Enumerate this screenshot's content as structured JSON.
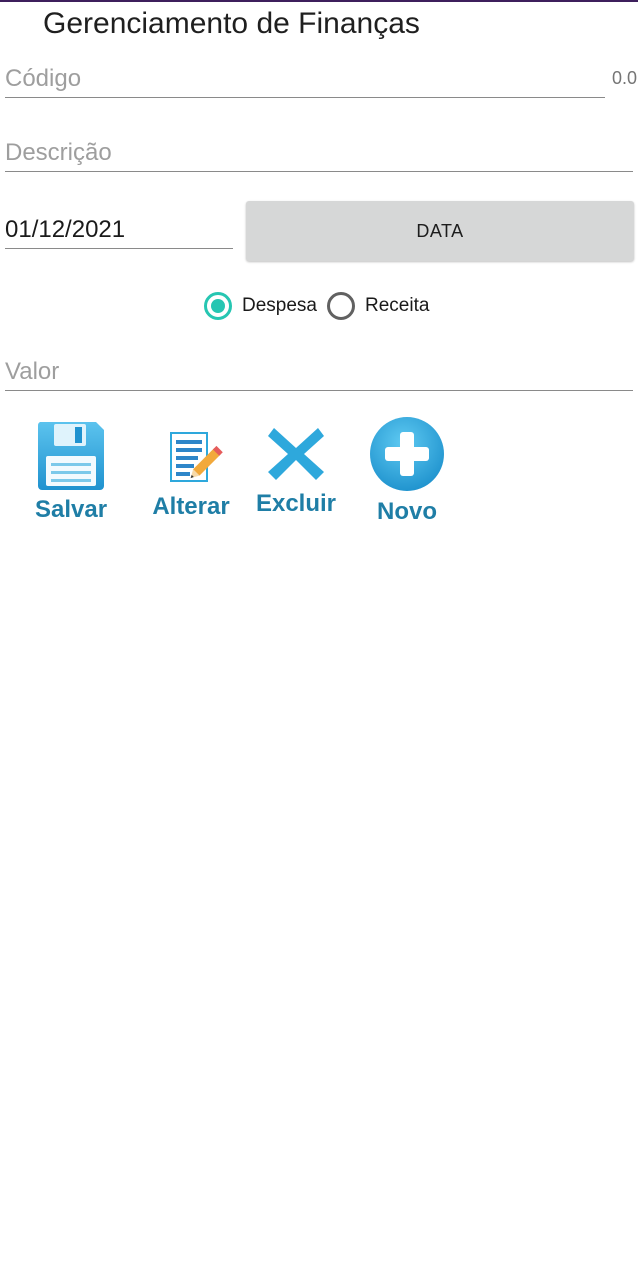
{
  "app": {
    "title": "Gerenciamento de Finanças"
  },
  "form": {
    "codigo": {
      "placeholder": "Código",
      "value": "",
      "suffix": "0.0"
    },
    "descricao": {
      "placeholder": "Descrição",
      "value": ""
    },
    "data": {
      "value": "01/12/2021",
      "button_label": "DATA"
    },
    "tipo": {
      "options": [
        {
          "label": "Despesa",
          "selected": true
        },
        {
          "label": "Receita",
          "selected": false
        }
      ]
    },
    "valor": {
      "placeholder": "Valor",
      "value": ""
    }
  },
  "actions": [
    {
      "label": "Salvar",
      "icon": "floppy-disk-icon"
    },
    {
      "label": "Alterar",
      "icon": "edit-document-icon"
    },
    {
      "label": "Excluir",
      "icon": "x-icon"
    },
    {
      "label": "Novo",
      "icon": "plus-circle-icon"
    }
  ],
  "colors": {
    "accent": "#26c6b2",
    "action_text": "#1f7ea6",
    "icon_blue": "#2ea8dc",
    "button_bg": "#d6d7d7",
    "status_bar": "#3d1f5c"
  }
}
